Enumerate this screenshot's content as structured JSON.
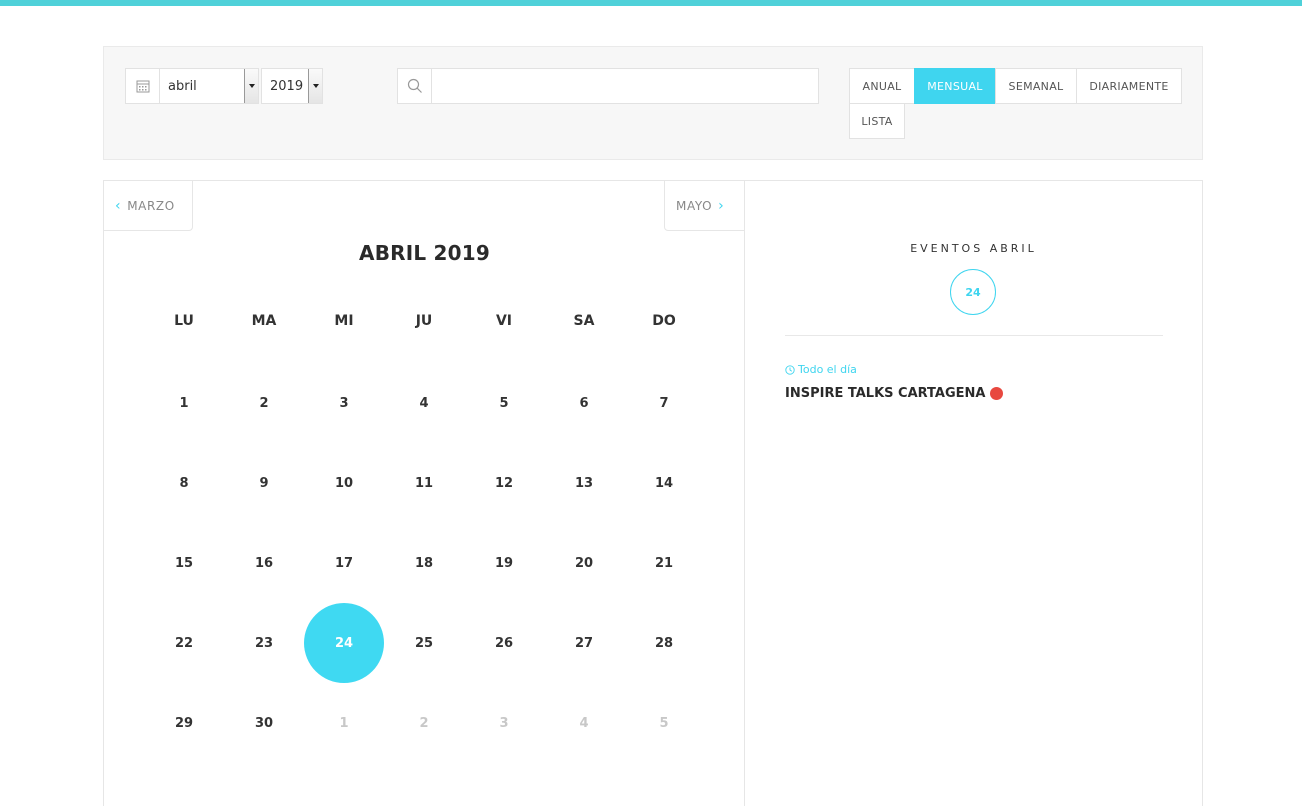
{
  "filters": {
    "month_value": "abril",
    "year_value": "2019",
    "search_value": "",
    "views": [
      {
        "label": "ANUAL",
        "active": false
      },
      {
        "label": "MENSUAL",
        "active": true
      },
      {
        "label": "SEMANAL",
        "active": false
      },
      {
        "label": "DIARIAMENTE",
        "active": false
      },
      {
        "label": "LISTA",
        "active": false
      }
    ]
  },
  "calendar": {
    "prev_label": "MARZO",
    "next_label": "MAYO",
    "title": "ABRIL 2019",
    "weekdays": [
      "LU",
      "MA",
      "MI",
      "JU",
      "VI",
      "SA",
      "DO"
    ],
    "days": [
      {
        "n": "1",
        "other": false
      },
      {
        "n": "2",
        "other": false
      },
      {
        "n": "3",
        "other": false
      },
      {
        "n": "4",
        "other": false
      },
      {
        "n": "5",
        "other": false
      },
      {
        "n": "6",
        "other": false
      },
      {
        "n": "7",
        "other": false
      },
      {
        "n": "8",
        "other": false
      },
      {
        "n": "9",
        "other": false
      },
      {
        "n": "10",
        "other": false
      },
      {
        "n": "11",
        "other": false
      },
      {
        "n": "12",
        "other": false
      },
      {
        "n": "13",
        "other": false
      },
      {
        "n": "14",
        "other": false
      },
      {
        "n": "15",
        "other": false
      },
      {
        "n": "16",
        "other": false
      },
      {
        "n": "17",
        "other": false
      },
      {
        "n": "18",
        "other": false
      },
      {
        "n": "19",
        "other": false
      },
      {
        "n": "20",
        "other": false
      },
      {
        "n": "21",
        "other": false
      },
      {
        "n": "22",
        "other": false
      },
      {
        "n": "23",
        "other": false
      },
      {
        "n": "24",
        "other": false,
        "selected": true
      },
      {
        "n": "25",
        "other": false
      },
      {
        "n": "26",
        "other": false
      },
      {
        "n": "27",
        "other": false
      },
      {
        "n": "28",
        "other": false
      },
      {
        "n": "29",
        "other": false
      },
      {
        "n": "30",
        "other": false
      },
      {
        "n": "1",
        "other": true
      },
      {
        "n": "2",
        "other": true
      },
      {
        "n": "3",
        "other": true
      },
      {
        "n": "4",
        "other": true
      },
      {
        "n": "5",
        "other": true
      }
    ]
  },
  "events_panel": {
    "heading": "EVENTOS ABRIL",
    "selected_day": "24",
    "events": [
      {
        "time": "Todo el día",
        "title": "INSPIRE TALKS CARTAGENA",
        "dot_color": "#e8483f"
      }
    ]
  },
  "colors": {
    "accent": "#3fd5ef",
    "top_bar": "#4fd1d9",
    "event_dot": "#e8483f"
  }
}
